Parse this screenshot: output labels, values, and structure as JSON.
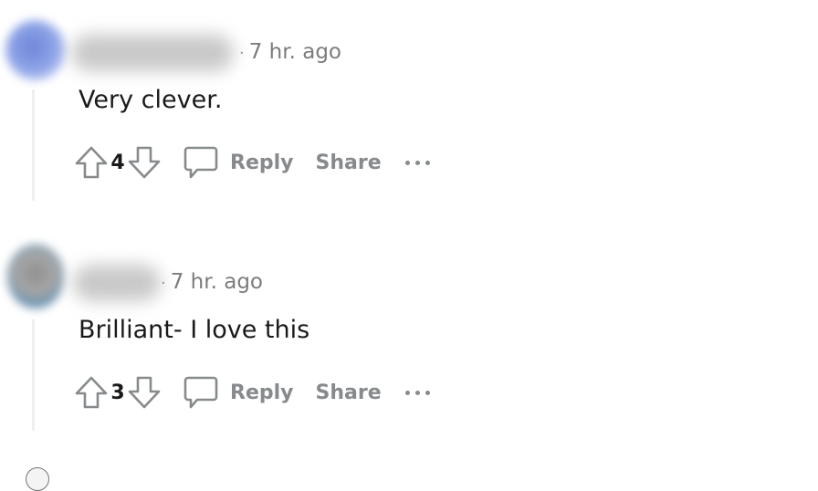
{
  "comments": [
    {
      "timestamp": "7 hr. ago",
      "text": "Very clever.",
      "score": "4",
      "reply_label": "Reply",
      "share_label": "Share"
    },
    {
      "timestamp": "7 hr. ago",
      "text": "Brilliant- I love this",
      "score": "3",
      "reply_label": "Reply",
      "share_label": "Share"
    }
  ],
  "icons": {
    "upvote": "upvote-arrow-icon",
    "downvote": "downvote-arrow-icon",
    "reply": "speech-bubble-icon",
    "more": "ellipsis-icon"
  },
  "colors": {
    "text": "#1a1a1b",
    "muted": "#878a8c",
    "meta": "#7c7c7c",
    "thread_line": "#edeff1"
  }
}
